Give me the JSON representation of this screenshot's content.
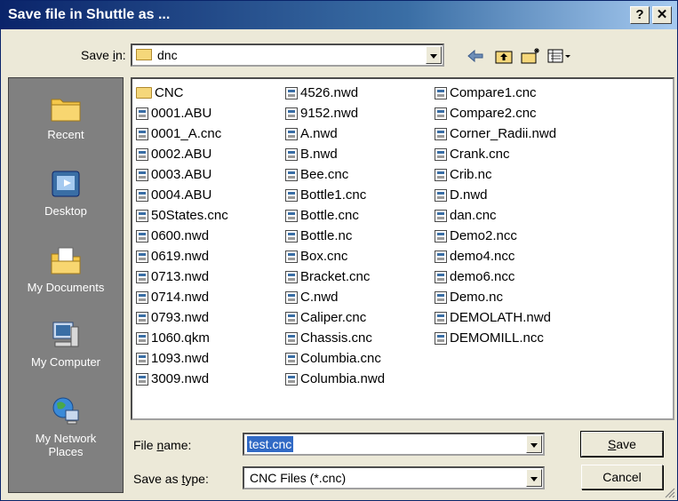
{
  "window": {
    "title": "Save file in Shuttle as ...",
    "help_label": "?",
    "close_label": "✕"
  },
  "save_in": {
    "label": "Save in:",
    "value": "dnc"
  },
  "places": [
    {
      "label": "Recent",
      "icon": "recent-folder-icon"
    },
    {
      "label": "Desktop",
      "icon": "desktop-icon"
    },
    {
      "label": "My Documents",
      "icon": "my-documents-icon"
    },
    {
      "label": "My Computer",
      "icon": "my-computer-icon"
    },
    {
      "label": "My Network Places",
      "icon": "network-places-icon"
    }
  ],
  "files": {
    "col1": [
      "CNC",
      "0001.ABU",
      "0001_A.cnc",
      "0002.ABU",
      "0003.ABU",
      "0004.ABU",
      "50States.cnc",
      "0600.nwd",
      "0619.nwd",
      "0713.nwd",
      "0714.nwd",
      "0793.nwd",
      "1060.qkm",
      "1093.nwd",
      "3009.nwd"
    ],
    "col2": [
      "4526.nwd",
      "9152.nwd",
      "A.nwd",
      "B.nwd",
      "Bee.cnc",
      "Bottle1.cnc",
      "Bottle.cnc",
      "Bottle.nc",
      "Box.cnc",
      "Bracket.cnc",
      "C.nwd",
      "Caliper.cnc",
      "Chassis.cnc",
      "Columbia.cnc",
      "Columbia.nwd"
    ],
    "col3": [
      "Compare1.cnc",
      "Compare2.cnc",
      "Corner_Radii.nwd",
      "Crank.cnc",
      "Crib.nc",
      "D.nwd",
      "dan.cnc",
      "Demo2.ncc",
      "demo4.ncc",
      "demo6.ncc",
      "Demo.nc",
      "DEMOLATH.nwd",
      "DEMOMILL.ncc"
    ]
  },
  "filename": {
    "label_pre": "File ",
    "label_u": "n",
    "label_post": "ame:",
    "value": "test.cnc"
  },
  "savetype": {
    "label_pre": "Save as ",
    "label_u": "t",
    "label_post": "ype:",
    "value": "CNC Files (*.cnc)"
  },
  "buttons": {
    "save_u": "S",
    "save_rest": "ave",
    "cancel": "Cancel"
  }
}
